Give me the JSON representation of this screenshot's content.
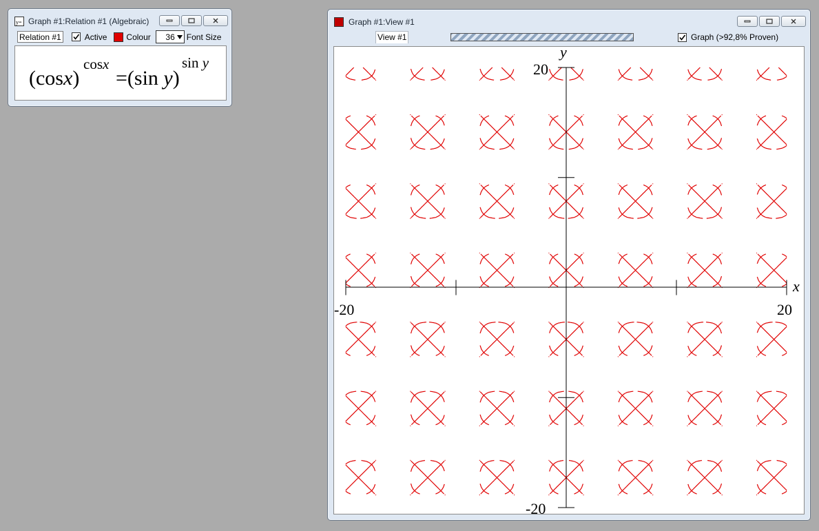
{
  "relation_window": {
    "title": "Graph #1:Relation #1 (Algebraic)",
    "relation_name": "Relation #1",
    "active_label": "Active",
    "active_checked": true,
    "colour_label": "Colour",
    "colour": "#e00000",
    "font_size_value": "36",
    "font_size_label": "Font Size",
    "equation": {
      "lhs_open": "(cos",
      "lhs_var": "x",
      "lhs_close": ")",
      "lhs_exp_fn": "cos",
      "lhs_exp_var": "x",
      "equals": "=",
      "rhs_open": "(sin ",
      "rhs_var": "y",
      "rhs_close": ")",
      "rhs_exp_fn": "sin ",
      "rhs_exp_var": "y"
    }
  },
  "view_window": {
    "title": "Graph #1:View #1",
    "tab_label": "View #1",
    "graph_checked": true,
    "graph_label": "Graph (>92,8% Proven)"
  },
  "chart_data": {
    "type": "scatter",
    "relation": "(cos x)^(cos x) = (sin y)^(sin y)",
    "xlabel": "x",
    "ylabel": "y",
    "xlim": [
      -20,
      20
    ],
    "ylim": [
      -20,
      20
    ],
    "tick_labels": {
      "x_min": "-20",
      "x_max": "20",
      "y_min": "-20",
      "y_max": "20"
    },
    "x_ticks": [
      -20,
      -10,
      10,
      20
    ],
    "y_ticks": [
      -20,
      -10,
      10,
      20
    ],
    "grid": false,
    "curve_color": "#e00000"
  }
}
